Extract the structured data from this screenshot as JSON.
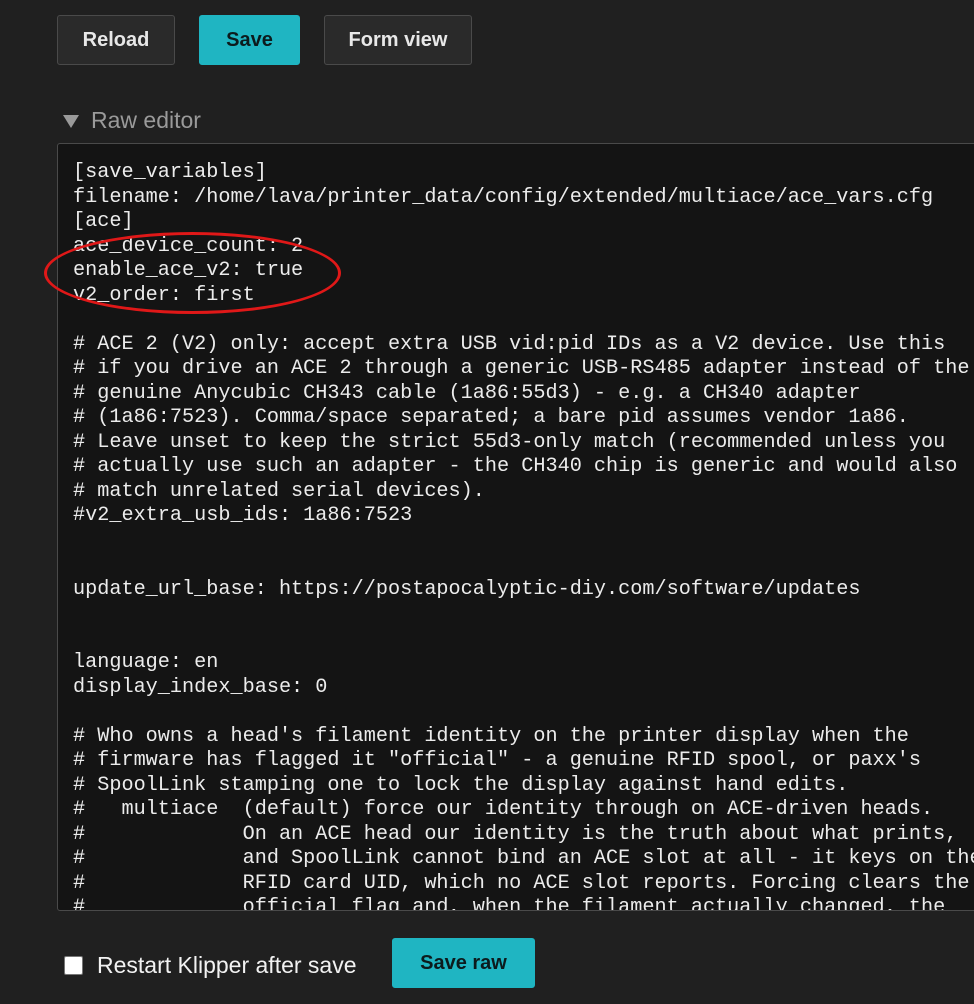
{
  "toolbar": {
    "reload_label": "Reload",
    "save_label": "Save",
    "form_view_label": "Form view"
  },
  "raw_editor": {
    "heading": "Raw editor",
    "lines": [
      "[save_variables]",
      "filename: /home/lava/printer_data/config/extended/multiace/ace_vars.cfg",
      "[ace]",
      "ace_device_count: 2",
      "enable_ace_v2: true",
      "v2_order: first",
      "",
      "# ACE 2 (V2) only: accept extra USB vid:pid IDs as a V2 device. Use this",
      "# if you drive an ACE 2 through a generic USB-RS485 adapter instead of the",
      "# genuine Anycubic CH343 cable (1a86:55d3) - e.g. a CH340 adapter",
      "# (1a86:7523). Comma/space separated; a bare pid assumes vendor 1a86.",
      "# Leave unset to keep the strict 55d3-only match (recommended unless you",
      "# actually use such an adapter - the CH340 chip is generic and would also",
      "# match unrelated serial devices).",
      "#v2_extra_usb_ids: 1a86:7523",
      "",
      "",
      "update_url_base: https://postapocalyptic-diy.com/software/updates",
      "",
      "",
      "language: en",
      "display_index_base: 0",
      "",
      "# Who owns a head's filament identity on the printer display when the",
      "# firmware has flagged it \"official\" - a genuine RFID spool, or paxx's",
      "# SpoolLink stamping one to lock the display against hand edits.",
      "#   multiace  (default) force our identity through on ACE-driven heads.",
      "#             On an ACE head our identity is the truth about what prints,",
      "#             and SpoolLink cannot bind an ACE slot at all - it keys on the",
      "#             RFID card UID, which no ACE slot reports. Forcing clears the",
      "#             official flag and, when the filament actually changed, the"
    ]
  },
  "footer": {
    "restart_label": "Restart Klipper after save",
    "restart_checked": false,
    "save_raw_label": "Save raw"
  },
  "colors": {
    "accent": "#1fb5c2",
    "highlight_ring": "#e01818",
    "background": "#202020",
    "editor_background": "#141414"
  }
}
